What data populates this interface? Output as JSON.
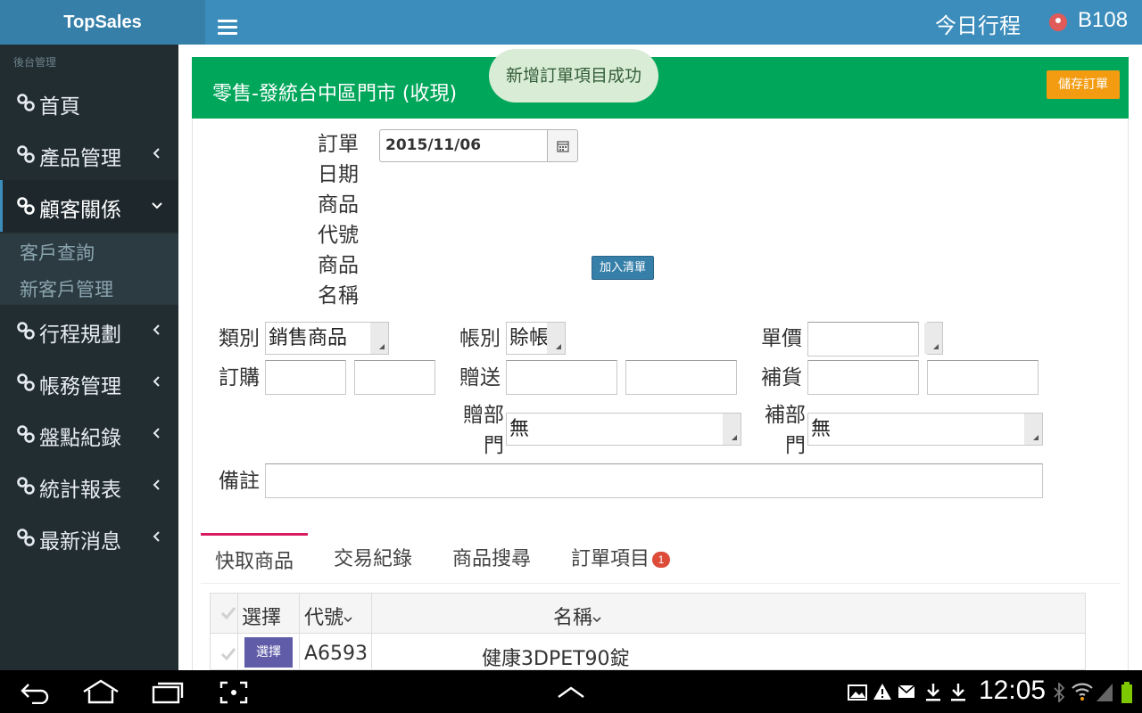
{
  "app": {
    "brand": "TopSales"
  },
  "topbar": {
    "today_label": "今日行程",
    "user": "B108"
  },
  "sidebar": {
    "header": "後台管理",
    "items": [
      {
        "label": "首頁"
      },
      {
        "label": "產品管理"
      },
      {
        "label": "顧客關係"
      },
      {
        "label": "行程規劃"
      },
      {
        "label": "帳務管理"
      },
      {
        "label": "盤點紀錄"
      },
      {
        "label": "統計報表"
      },
      {
        "label": "最新消息"
      }
    ],
    "submenu": [
      {
        "label": "客戶查詢"
      },
      {
        "label": "新客戶管理"
      }
    ]
  },
  "box": {
    "title": "零售-發統台中區門市 (收現)",
    "toast": "新增訂單項目成功",
    "save_label": "儲存訂單"
  },
  "form": {
    "order_date_label": "訂單日期",
    "order_date_value": "2015/11/06",
    "product_code_label": "商品代號",
    "product_name_label": "商品名稱",
    "add_list_label": "加入清單",
    "category_label": "類別",
    "category_value": "銷售商品",
    "account_label": "帳別",
    "account_value": "賒帳",
    "unit_price_label": "單價",
    "order_qty_label": "訂購",
    "gift_label": "贈送",
    "restock_label": "補貨",
    "gift_dept_label": "贈部門",
    "gift_dept_value": "無",
    "restock_dept_label": "補部門",
    "restock_dept_value": "無",
    "note_label": "備註"
  },
  "tabs": [
    {
      "label": "快取商品"
    },
    {
      "label": "交易紀錄"
    },
    {
      "label": "商品搜尋"
    },
    {
      "label": "訂單項目",
      "badge": "1"
    }
  ],
  "table": {
    "headers": {
      "select": "選擇",
      "code": "代號",
      "name": "名稱"
    },
    "rows": [
      {
        "button": "選擇",
        "code": "A6593",
        "name": "健康3DPET90錠"
      }
    ]
  },
  "statusbar": {
    "time": "12:05"
  }
}
